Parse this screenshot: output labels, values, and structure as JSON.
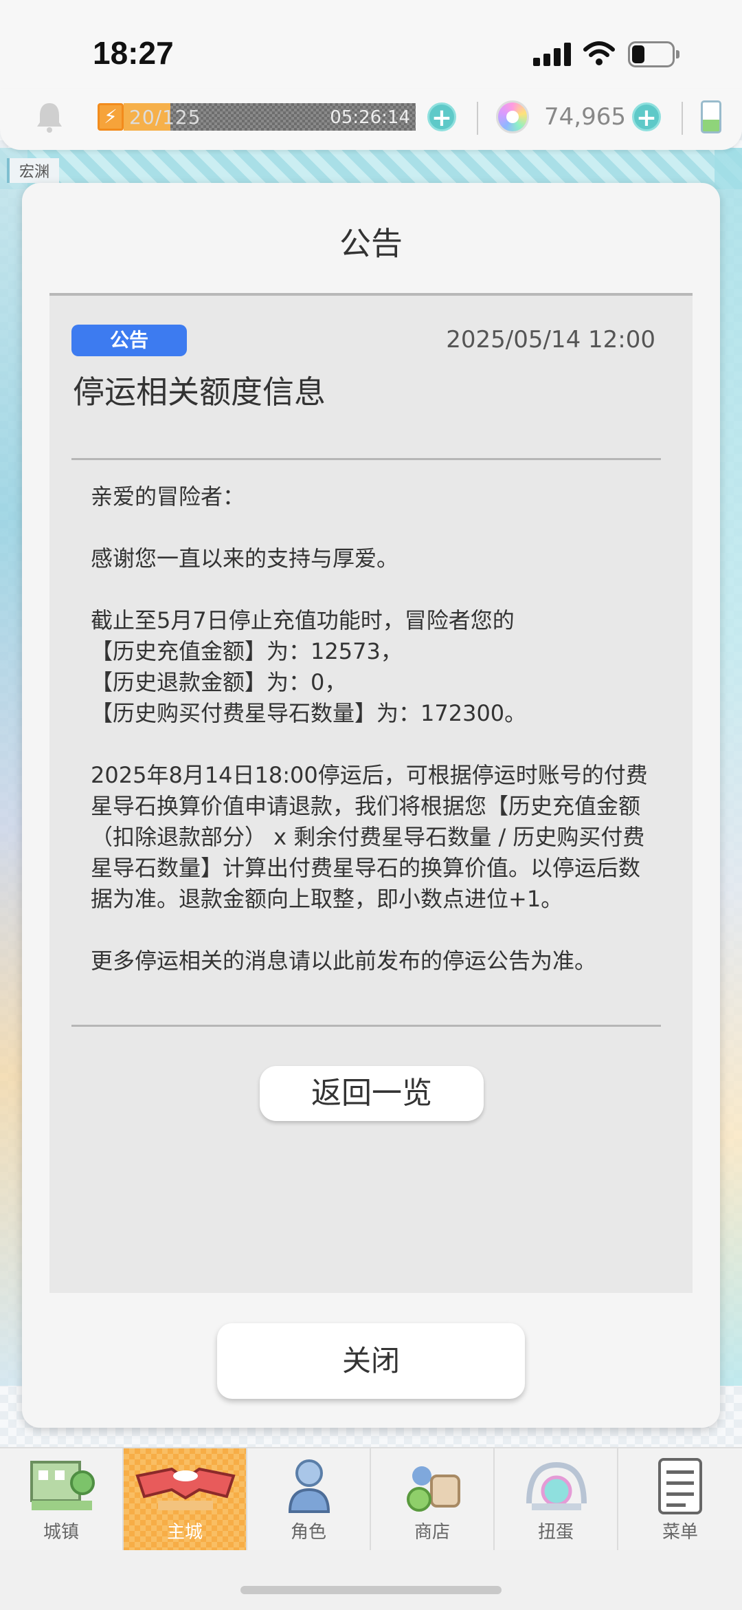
{
  "status_bar": {
    "time": "18:27"
  },
  "resources": {
    "stamina_text": "20/125",
    "stamina_fraction": 0.16,
    "stamina_timer": "05:26:14",
    "gems": "74,965"
  },
  "background": {
    "region_label": "宏渊"
  },
  "modal": {
    "title": "公告",
    "badge": "公告",
    "date": "2025/05/14 12:00",
    "post_title": "停运相关额度信息",
    "body": {
      "greeting": "亲爱的冒险者：",
      "thanks": "感谢您一直以来的支持与厚爱。",
      "intro": "截止至5月7日停止充值功能时，冒险者您的",
      "line_recharge": "【历史充值金额】为：12573，",
      "line_refund": "【历史退款金额】为：0，",
      "line_purchase": "【历史购买付费星导石数量】为：172300。",
      "refund_rule": "2025年8月14日18:00停运后，可根据停运时账号的付费星导石换算价值申请退款，我们将根据您【历史充值金额（扣除退款部分） x 剩余付费星导石数量 / 历史购买付费星导石数量】计算出付费星导石的换算价值。以停运后数据为准。退款金额向上取整，即小数点进位+1。",
      "more_info": "更多停运相关的消息请以此前发布的停运公告为准。"
    },
    "back_label": "返回一览",
    "close_label": "关闭"
  },
  "bottom_nav": {
    "items": [
      {
        "label": "城镇",
        "icon": "town-icon"
      },
      {
        "label": "主城",
        "icon": "main-city-icon",
        "active": true
      },
      {
        "label": "角色",
        "icon": "character-icon"
      },
      {
        "label": "商店",
        "icon": "shop-icon"
      },
      {
        "label": "扭蛋",
        "icon": "gacha-icon"
      },
      {
        "label": "菜单",
        "icon": "menu-icon"
      }
    ]
  },
  "colors": {
    "badge_blue": "#3d7bf0",
    "plus_teal": "#5ec9c8",
    "stamina_orange": "#f6b04a",
    "nav_active": "#f7ad46"
  }
}
